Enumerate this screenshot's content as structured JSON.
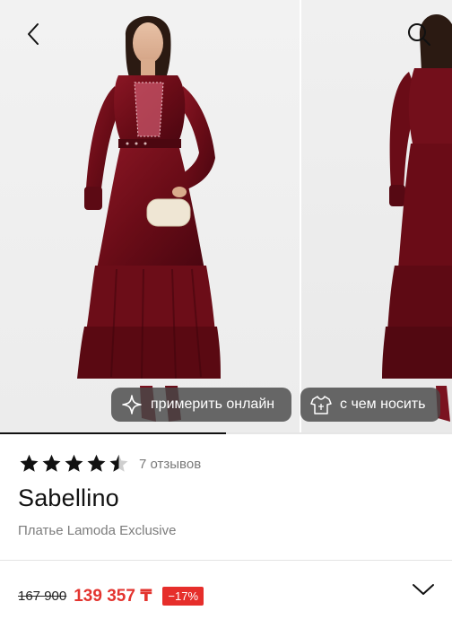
{
  "gallery": {
    "photo_count": 2,
    "current_photo": 1,
    "progress_fraction": 0.5,
    "buttons": {
      "try_online": "примерить онлайн",
      "what_to_wear": "с чем носить"
    }
  },
  "product": {
    "rating": 4.5,
    "rating_max": 5,
    "reviews_label": "7 отзывов",
    "brand": "Sabellino",
    "name": "Платье Lamoda Exclusive"
  },
  "price": {
    "old": "167 900",
    "new": "139 357 ₸",
    "discount": "−17%"
  },
  "colors": {
    "price_accent": "#e3342f",
    "discount_badge": "#e62e2b",
    "dress": "#6e0e18",
    "pill_background": "#484848"
  },
  "icons": {
    "back": "chevron-left-icon",
    "search": "search-icon",
    "try_online": "sparkle-icon",
    "what_to_wear": "outfit-icon",
    "expand": "chevron-down-icon",
    "star": "star-icon"
  }
}
